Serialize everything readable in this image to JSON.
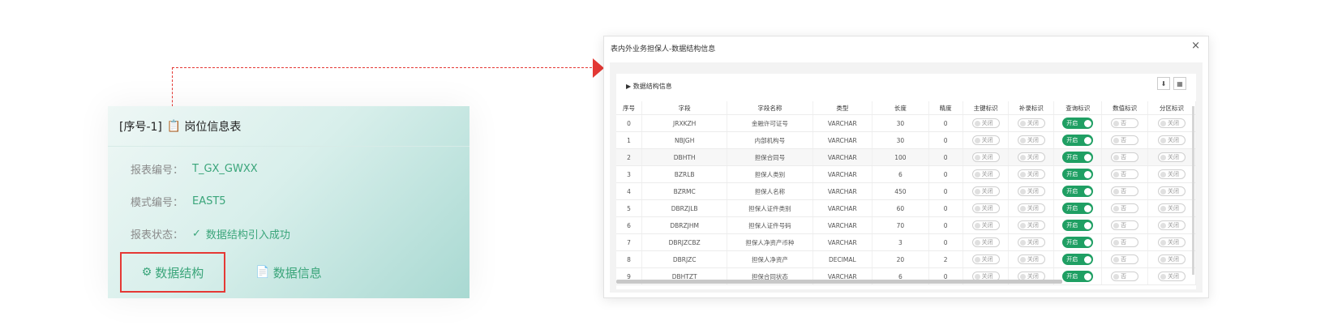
{
  "card": {
    "seq": "[序号-1]",
    "title": "岗位信息表",
    "report_code_label": "报表编号：",
    "report_code_value": "T_GX_GWXX",
    "mode_code_label": "模式编号：",
    "mode_code_value": "EAST5",
    "status_label": "报表状态：",
    "status_value": "数据结构引入成功",
    "btn_struct": "数据结构",
    "btn_info": "数据信息"
  },
  "modal": {
    "title": "表内外业务担保人-数据结构信息",
    "close": "×",
    "panel_title": "数据结构信息",
    "columns": [
      "序号",
      "字段",
      "字段名称",
      "类型",
      "长度",
      "精度",
      "主键标识",
      "补录标识",
      "查询标识",
      "数值标识",
      "分区标识"
    ],
    "rows": [
      {
        "no": "0",
        "field": "JRXKZH",
        "name": "金融许可证号",
        "type": "VARCHAR",
        "len": "30",
        "prec": "0"
      },
      {
        "no": "1",
        "field": "NBJGH",
        "name": "内部机构号",
        "type": "VARCHAR",
        "len": "30",
        "prec": "0"
      },
      {
        "no": "2",
        "field": "DBHTH",
        "name": "担保合同号",
        "type": "VARCHAR",
        "len": "100",
        "prec": "0"
      },
      {
        "no": "3",
        "field": "BZRLB",
        "name": "担保人类别",
        "type": "VARCHAR",
        "len": "6",
        "prec": "0"
      },
      {
        "no": "4",
        "field": "BZRMC",
        "name": "担保人名称",
        "type": "VARCHAR",
        "len": "450",
        "prec": "0"
      },
      {
        "no": "5",
        "field": "DBRZJLB",
        "name": "担保人证件类别",
        "type": "VARCHAR",
        "len": "60",
        "prec": "0"
      },
      {
        "no": "6",
        "field": "DBRZJHM",
        "name": "担保人证件号码",
        "type": "VARCHAR",
        "len": "70",
        "prec": "0"
      },
      {
        "no": "7",
        "field": "DBRJZCBZ",
        "name": "担保人净资产币种",
        "type": "VARCHAR",
        "len": "3",
        "prec": "0"
      },
      {
        "no": "8",
        "field": "DBRJZC",
        "name": "担保人净资产",
        "type": "DECIMAL",
        "len": "20",
        "prec": "2"
      },
      {
        "no": "9",
        "field": "DBHTZT",
        "name": "担保合同状态",
        "type": "VARCHAR",
        "len": "6",
        "prec": "0"
      }
    ],
    "toggle_off": "关闭",
    "toggle_on": "开启",
    "toggle_no": "否"
  },
  "colors": {
    "accent": "#3aa57a",
    "switch_on": "#1f9f63",
    "highlight": "#e53935"
  }
}
